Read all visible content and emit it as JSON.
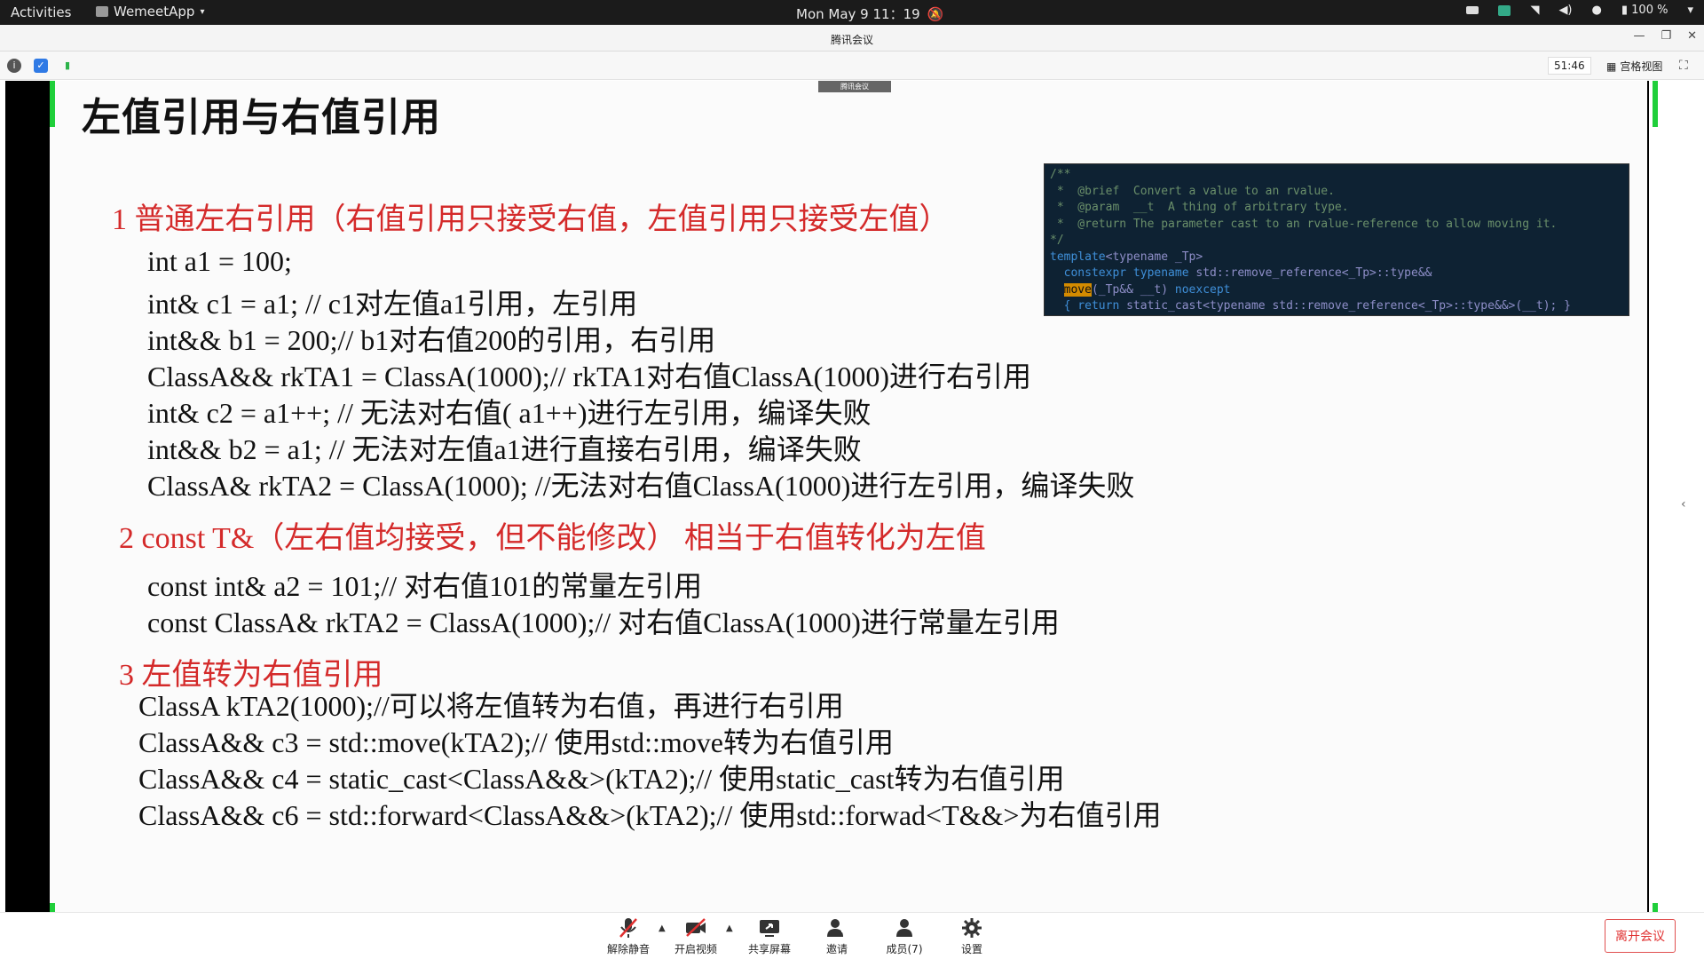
{
  "topbar": {
    "activities": "Activities",
    "app_menu": "WemeetApp",
    "clock": "Mon May 9  11：19",
    "battery": "100 %"
  },
  "window": {
    "title": "腾讯会议"
  },
  "toolrow": {
    "timer": "51:46",
    "grid_view": "宫格视图"
  },
  "slide": {
    "tag": "腾讯会议",
    "title": "左值引用与右值引用",
    "sections": [
      {
        "heading": "1 普通左右引用（右值引用只接受右值，左值引用只接受左值）",
        "lines": [
          "int a1 = 100;",
          "int& c1 = a1;      // c1对左值a1引用，左引用",
          "int&& b1 = 200;// b1对右值200的引用，右引用",
          "ClassA&& rkTA1 = ClassA(1000);// rkTA1对右值ClassA(1000)进行右引用",
          "int& c2 = a1++; // 无法对右值( a1++)进行左引用，编译失败",
          "int&& b2 = a1;  // 无法对左值a1进行直接右引用，编译失败",
          "ClassA& rkTA2 = ClassA(1000); //无法对右值ClassA(1000)进行左引用，编译失败"
        ]
      },
      {
        "heading": "2 const T&（左右值均接受，但不能修改） 相当于右值转化为左值",
        "lines": [
          "const int& a2 = 101;// 对右值101的常量左引用",
          "const ClassA& rkTA2 = ClassA(1000);// 对右值ClassA(1000)进行常量左引用"
        ]
      },
      {
        "heading": "3 左值转为右值引用",
        "lines": [
          "ClassA kTA2(1000);//可以将左值转为右值，再进行右引用",
          "ClassA&& c3 = std::move(kTA2);// 使用std::move转为右值引用",
          "ClassA&& c4 = static_cast<ClassA&&>(kTA2);// 使用static_cast转为右值引用",
          "ClassA&& c6 = std::forward<ClassA&&>(kTA2);// 使用std::forwad<T&&>为右值引用"
        ]
      }
    ],
    "code": {
      "l1": "/**",
      "l2": " *  @brief  Convert a value to an rvalue.",
      "l3": " *  @param  __t  A thing of arbitrary type.",
      "l4": " *  @return The parameter cast to an rvalue-reference to allow moving it.",
      "l5": "*/",
      "l6a": "template",
      "l6b": "<typename _Tp>",
      "l7a": "  constexpr typename ",
      "l7b": "std::remove_reference<_Tp>::type&&",
      "l8a": "move",
      "l8b": "(_Tp&& __t) ",
      "l8c": "noexcept",
      "l9a": "  { return ",
      "l9b": "static_cast<typename std::remove_reference<_Tp>::type&&>(__t); }"
    }
  },
  "bottom": {
    "unmute": "解除静音",
    "video": "开启视频",
    "share": "共享屏幕",
    "invite": "邀请",
    "members": "成员(7)",
    "settings": "设置",
    "leave": "离开会议"
  }
}
